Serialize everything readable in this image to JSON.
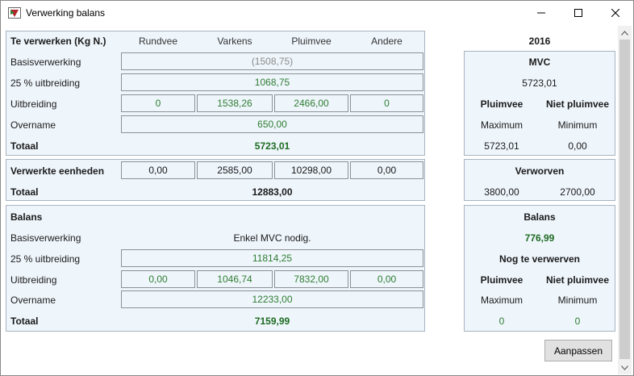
{
  "window": {
    "title": "Verwerking balans"
  },
  "icons": {
    "app": "app-logo-icon",
    "minimize": "minimize-icon",
    "maximize": "maximize-icon",
    "close": "close-icon",
    "scroll_up": "arrow-up-icon",
    "scroll_down": "arrow-down-icon"
  },
  "headers": {
    "title": "Te verwerken (Kg N.)",
    "rundvee": "Rundvee",
    "varkens": "Varkens",
    "pluimvee": "Pluimvee",
    "andere": "Andere",
    "year": "2016"
  },
  "verwerken": {
    "basis_label": "Basisverwerking",
    "basis_value": "(1508,75)",
    "uitbr25_label": "25 % uitbreiding",
    "uitbr25_value": "1068,75",
    "uitbreiding_label": "Uitbreiding",
    "uitbreiding_values": [
      "0",
      "1538,26",
      "2466,00",
      "0"
    ],
    "overname_label": "Overname",
    "overname_value": "650,00",
    "totaal_label": "Totaal",
    "totaal_value": "5723,01"
  },
  "eenheden": {
    "label": "Verwerkte eenheden",
    "values": [
      "0,00",
      "2585,00",
      "10298,00",
      "0,00"
    ],
    "totaal_label": "Totaal",
    "totaal_value": "12883,00"
  },
  "balans": {
    "title": "Balans",
    "basis_label": "Basisverwerking",
    "basis_value": "Enkel MVC nodig.",
    "uitbr25_label": "25 % uitbreiding",
    "uitbr25_value": "11814,25",
    "uitbreiding_label": "Uitbreiding",
    "uitbreiding_values": [
      "0,00",
      "1046,74",
      "7832,00",
      "0,00"
    ],
    "overname_label": "Overname",
    "overname_value": "12233,00",
    "totaal_label": "Totaal",
    "totaal_value": "7159,99"
  },
  "mvc": {
    "title": "MVC",
    "value": "5723,01",
    "pluimvee": "Pluimvee",
    "niet_pluimvee": "Niet pluimvee",
    "maximum": "Maximum",
    "minimum": "Minimum",
    "max_value": "5723,01",
    "min_value": "0,00"
  },
  "verworven": {
    "title": "Verworven",
    "value1": "3800,00",
    "value2": "2700,00"
  },
  "balans_right": {
    "title": "Balans",
    "value": "776,99",
    "nog_label": "Nog te verwerven",
    "pluimvee": "Pluimvee",
    "niet_pluimvee": "Niet pluimvee",
    "maximum": "Maximum",
    "minimum": "Minimum",
    "max_value": "0",
    "min_value": "0"
  },
  "buttons": {
    "aanpassen": "Aanpassen"
  },
  "colors": {
    "panel_bg": "#eef5fb",
    "value_green": "#2f7d32",
    "grey_value": "#8a8a8a"
  }
}
